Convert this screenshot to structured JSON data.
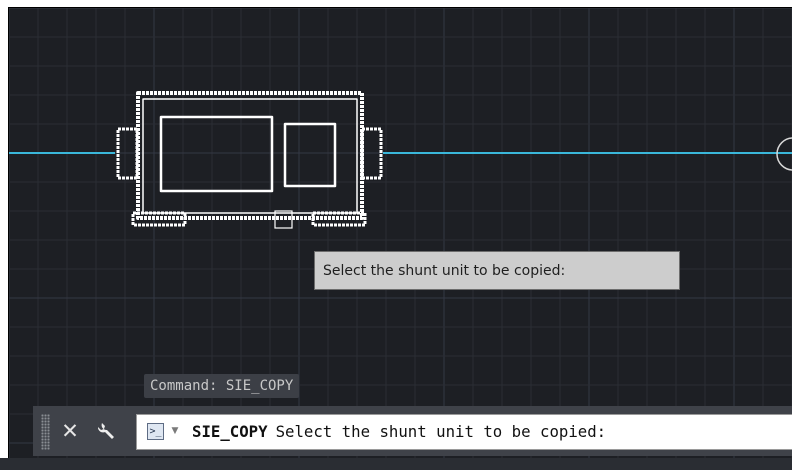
{
  "canvas": {
    "background_color": "#1d1f24",
    "grid_minor_color": "#2a2d34",
    "grid_major_color": "#343845",
    "busbar_color": "#3ab7da",
    "selection_color": "#ffffff"
  },
  "tooltip": {
    "text": "Select the shunt unit to be copied:"
  },
  "command_history": {
    "text": "Command: SIE_COPY"
  },
  "command_line": {
    "close_icon": "close-icon",
    "customize_icon": "wrench-icon",
    "prompt_icon": "command-prompt-icon",
    "dropdown_icon": "chevron-down-icon",
    "command_name": "SIE_COPY",
    "prompt_text": "Select the shunt unit to be copied:"
  }
}
